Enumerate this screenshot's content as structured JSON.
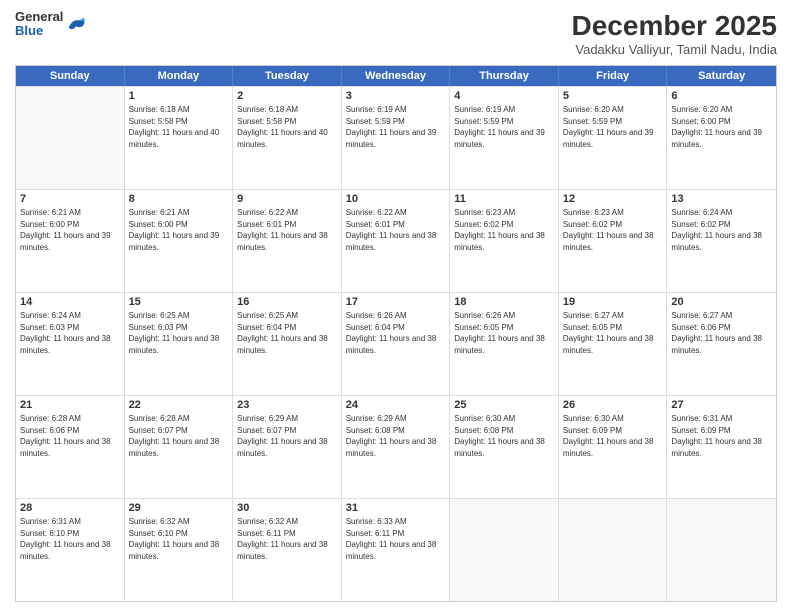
{
  "header": {
    "logo": {
      "general": "General",
      "blue": "Blue"
    },
    "title": "December 2025",
    "location": "Vadakku Valliyur, Tamil Nadu, India"
  },
  "weekdays": [
    "Sunday",
    "Monday",
    "Tuesday",
    "Wednesday",
    "Thursday",
    "Friday",
    "Saturday"
  ],
  "weeks": [
    [
      {
        "day": null
      },
      {
        "day": 1,
        "rise": "6:18 AM",
        "set": "5:58 PM",
        "daylight": "11 hours and 40 minutes."
      },
      {
        "day": 2,
        "rise": "6:18 AM",
        "set": "5:58 PM",
        "daylight": "11 hours and 40 minutes."
      },
      {
        "day": 3,
        "rise": "6:19 AM",
        "set": "5:59 PM",
        "daylight": "11 hours and 39 minutes."
      },
      {
        "day": 4,
        "rise": "6:19 AM",
        "set": "5:59 PM",
        "daylight": "11 hours and 39 minutes."
      },
      {
        "day": 5,
        "rise": "6:20 AM",
        "set": "5:59 PM",
        "daylight": "11 hours and 39 minutes."
      },
      {
        "day": 6,
        "rise": "6:20 AM",
        "set": "6:00 PM",
        "daylight": "11 hours and 39 minutes."
      }
    ],
    [
      {
        "day": 7,
        "rise": "6:21 AM",
        "set": "6:00 PM",
        "daylight": "11 hours and 39 minutes."
      },
      {
        "day": 8,
        "rise": "6:21 AM",
        "set": "6:00 PM",
        "daylight": "11 hours and 39 minutes."
      },
      {
        "day": 9,
        "rise": "6:22 AM",
        "set": "6:01 PM",
        "daylight": "11 hours and 38 minutes."
      },
      {
        "day": 10,
        "rise": "6:22 AM",
        "set": "6:01 PM",
        "daylight": "11 hours and 38 minutes."
      },
      {
        "day": 11,
        "rise": "6:23 AM",
        "set": "6:02 PM",
        "daylight": "11 hours and 38 minutes."
      },
      {
        "day": 12,
        "rise": "6:23 AM",
        "set": "6:02 PM",
        "daylight": "11 hours and 38 minutes."
      },
      {
        "day": 13,
        "rise": "6:24 AM",
        "set": "6:02 PM",
        "daylight": "11 hours and 38 minutes."
      }
    ],
    [
      {
        "day": 14,
        "rise": "6:24 AM",
        "set": "6:03 PM",
        "daylight": "11 hours and 38 minutes."
      },
      {
        "day": 15,
        "rise": "6:25 AM",
        "set": "6:03 PM",
        "daylight": "11 hours and 38 minutes."
      },
      {
        "day": 16,
        "rise": "6:25 AM",
        "set": "6:04 PM",
        "daylight": "11 hours and 38 minutes."
      },
      {
        "day": 17,
        "rise": "6:26 AM",
        "set": "6:04 PM",
        "daylight": "11 hours and 38 minutes."
      },
      {
        "day": 18,
        "rise": "6:26 AM",
        "set": "6:05 PM",
        "daylight": "11 hours and 38 minutes."
      },
      {
        "day": 19,
        "rise": "6:27 AM",
        "set": "6:05 PM",
        "daylight": "11 hours and 38 minutes."
      },
      {
        "day": 20,
        "rise": "6:27 AM",
        "set": "6:06 PM",
        "daylight": "11 hours and 38 minutes."
      }
    ],
    [
      {
        "day": 21,
        "rise": "6:28 AM",
        "set": "6:06 PM",
        "daylight": "11 hours and 38 minutes."
      },
      {
        "day": 22,
        "rise": "6:28 AM",
        "set": "6:07 PM",
        "daylight": "11 hours and 38 minutes."
      },
      {
        "day": 23,
        "rise": "6:29 AM",
        "set": "6:07 PM",
        "daylight": "11 hours and 38 minutes."
      },
      {
        "day": 24,
        "rise": "6:29 AM",
        "set": "6:08 PM",
        "daylight": "11 hours and 38 minutes."
      },
      {
        "day": 25,
        "rise": "6:30 AM",
        "set": "6:08 PM",
        "daylight": "11 hours and 38 minutes."
      },
      {
        "day": 26,
        "rise": "6:30 AM",
        "set": "6:09 PM",
        "daylight": "11 hours and 38 minutes."
      },
      {
        "day": 27,
        "rise": "6:31 AM",
        "set": "6:09 PM",
        "daylight": "11 hours and 38 minutes."
      }
    ],
    [
      {
        "day": 28,
        "rise": "6:31 AM",
        "set": "6:10 PM",
        "daylight": "11 hours and 38 minutes."
      },
      {
        "day": 29,
        "rise": "6:32 AM",
        "set": "6:10 PM",
        "daylight": "11 hours and 38 minutes."
      },
      {
        "day": 30,
        "rise": "6:32 AM",
        "set": "6:11 PM",
        "daylight": "11 hours and 38 minutes."
      },
      {
        "day": 31,
        "rise": "6:33 AM",
        "set": "6:11 PM",
        "daylight": "11 hours and 38 minutes."
      },
      {
        "day": null
      },
      {
        "day": null
      },
      {
        "day": null
      }
    ]
  ]
}
